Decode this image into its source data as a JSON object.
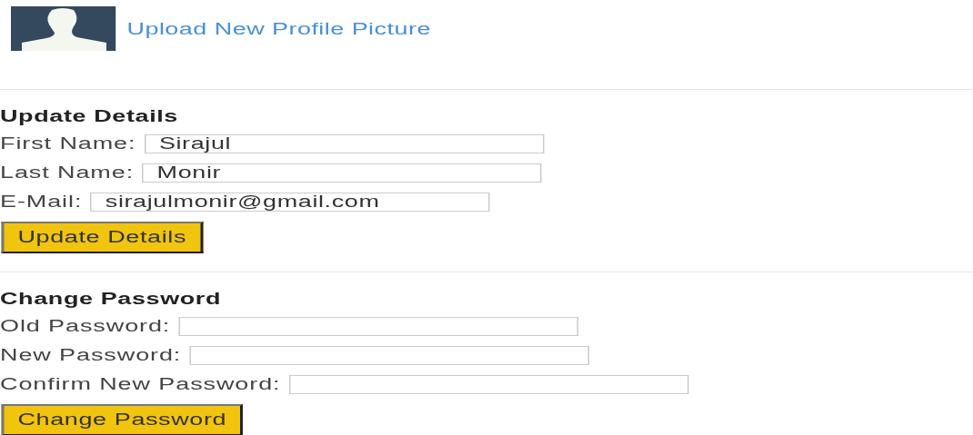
{
  "profile": {
    "upload_link": "Upload New Profile Picture"
  },
  "sections": [
    {
      "heading": "Update Details",
      "fields": [
        {
          "label": "First Name:",
          "value": "Sirajul"
        },
        {
          "label": "Last Name:",
          "value": "Monir"
        },
        {
          "label": "E-Mail:",
          "value": "sirajulmonir@gmail.com"
        }
      ],
      "button": "Update Details"
    },
    {
      "heading": "Change Password",
      "fields": [
        {
          "label": "Old Password:"
        },
        {
          "label": "New Password:"
        },
        {
          "label": "Confirm New Password:"
        }
      ],
      "button": "Change Password"
    }
  ]
}
